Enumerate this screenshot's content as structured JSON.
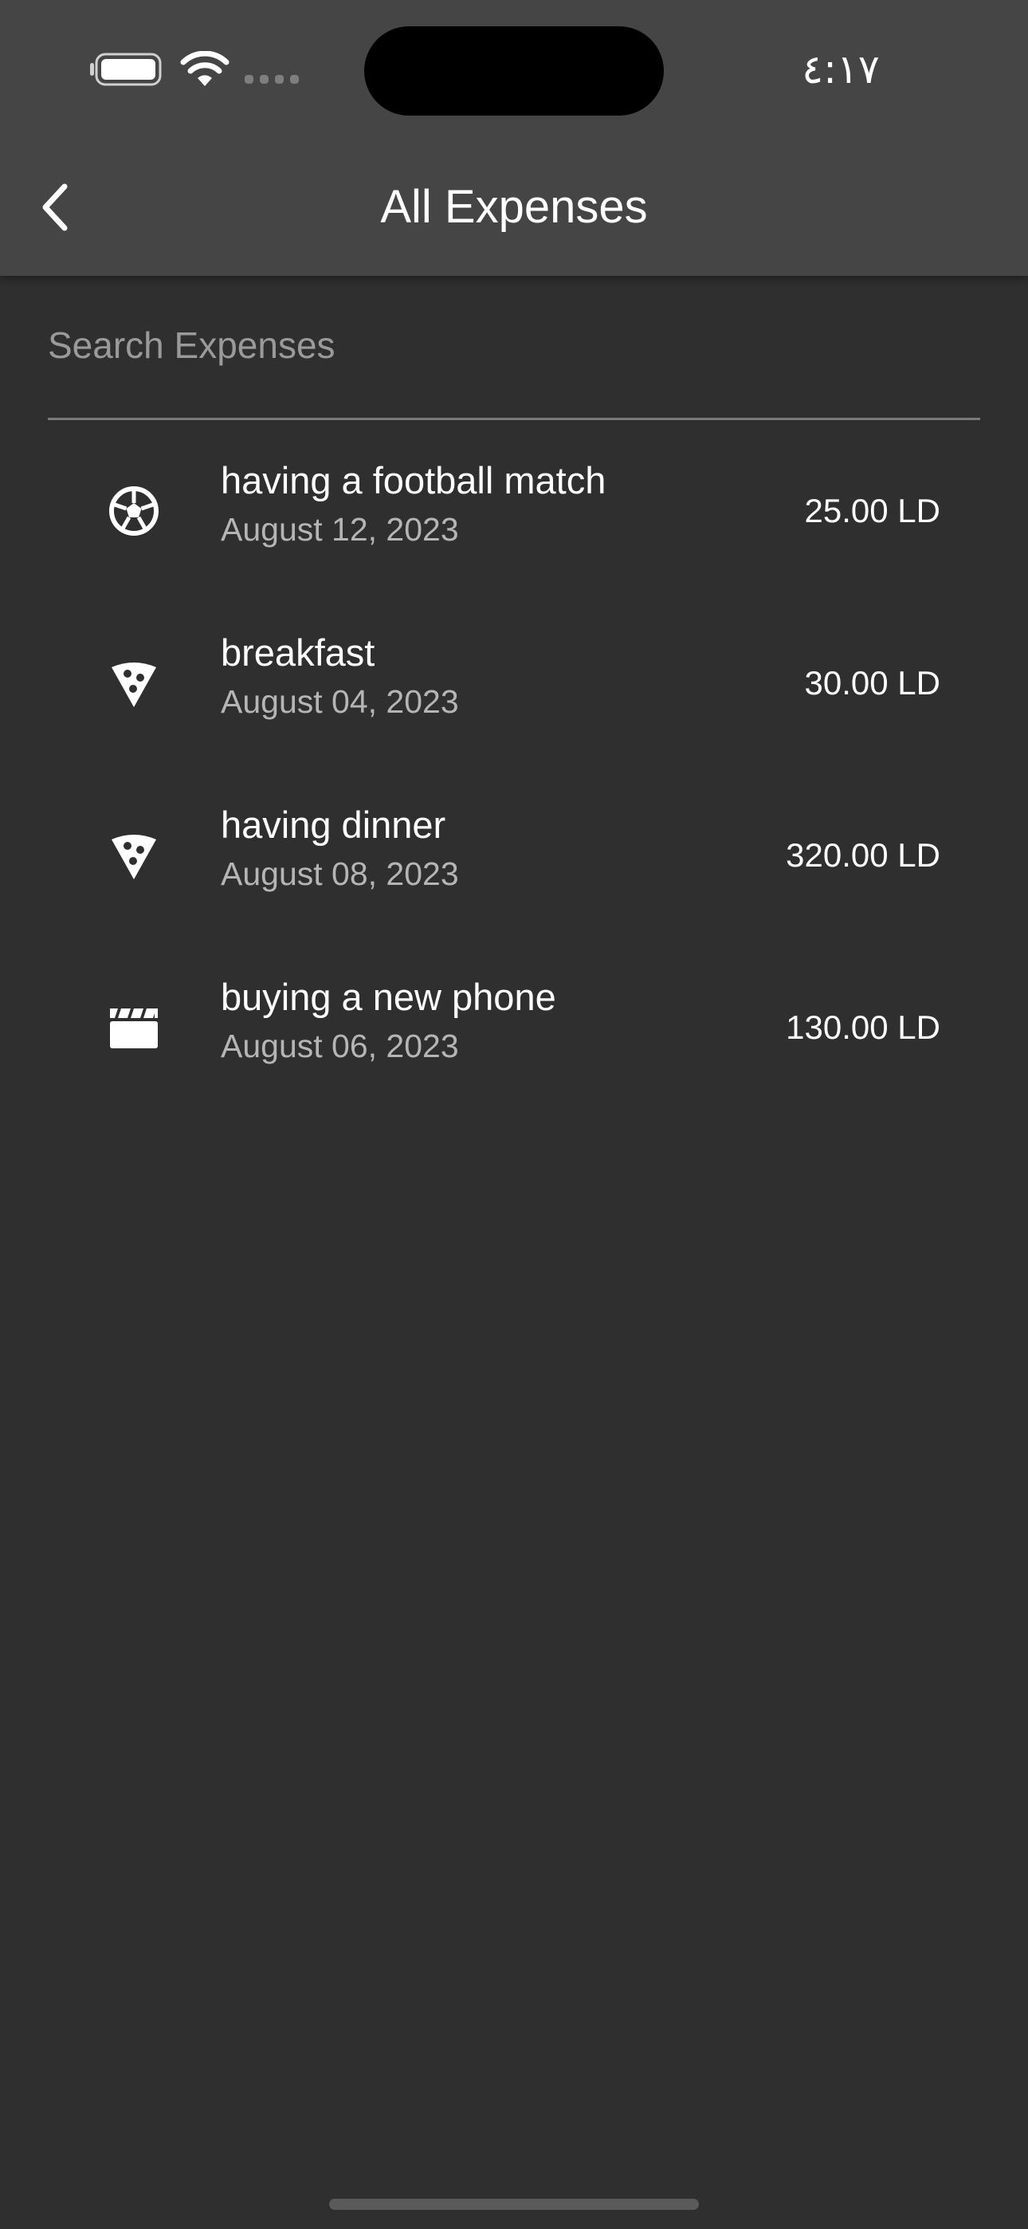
{
  "status_bar": {
    "time": "٤:١٧",
    "battery_icon": "battery-icon",
    "wifi_icon": "wifi-icon",
    "signal_icon": "cellular-signal-icon"
  },
  "header": {
    "title": "All Expenses",
    "back_icon": "chevron-left-icon"
  },
  "search": {
    "placeholder": "Search Expenses",
    "value": ""
  },
  "expenses": [
    {
      "title": "having a football match",
      "date": "August 12, 2023",
      "amount": "25.00 LD",
      "icon": "soccer-ball-icon"
    },
    {
      "title": "breakfast",
      "date": "August 04, 2023",
      "amount": "30.00 LD",
      "icon": "pizza-slice-icon"
    },
    {
      "title": "having dinner",
      "date": "August 08, 2023",
      "amount": "320.00 LD",
      "icon": "pizza-slice-icon"
    },
    {
      "title": "buying a new phone",
      "date": "August 06, 2023",
      "amount": "130.00 LD",
      "icon": "clapperboard-icon"
    }
  ],
  "colors": {
    "background": "#2f2f2f",
    "header": "#454545",
    "secondary_text": "#b5b5b5",
    "placeholder": "#9a9a9a",
    "divider": "#7a7a7a"
  }
}
